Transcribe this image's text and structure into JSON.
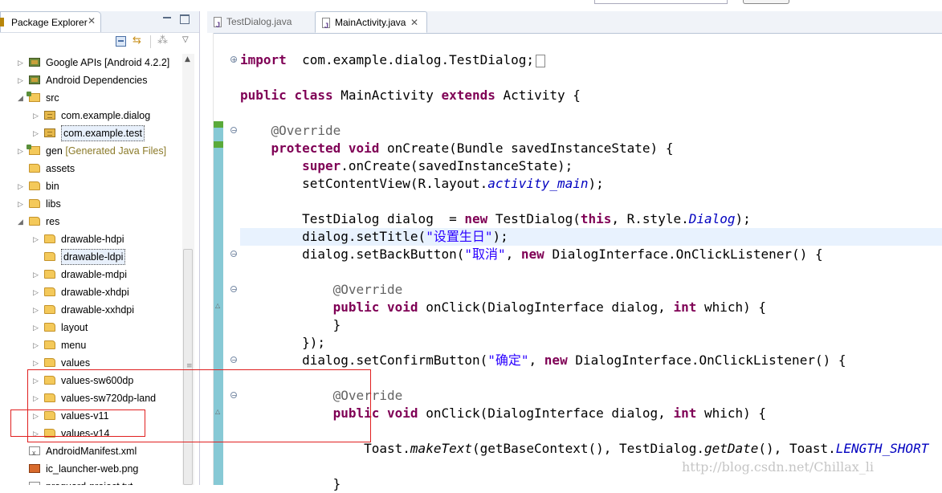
{
  "explorer": {
    "title": "Package Explorer",
    "close": "✕",
    "tree": [
      {
        "label": "Google APIs [Android 4.2.2]",
        "arrow": "▷",
        "icon": "library-icon",
        "indent": 0
      },
      {
        "label": "Android Dependencies",
        "arrow": "▷",
        "icon": "library-icon",
        "indent": 0
      },
      {
        "label": "src",
        "arrow": "◢",
        "icon": "source-folder-icon",
        "indent": 0
      },
      {
        "label": "com.example.dialog",
        "arrow": "▷",
        "icon": "package-icon",
        "indent": 1
      },
      {
        "label": "com.example.test",
        "arrow": "▷",
        "icon": "package-icon",
        "indent": 1,
        "selected": true
      },
      {
        "label": "gen",
        "sublabel": "[Generated Java Files]",
        "arrow": "▷",
        "icon": "source-folder-icon",
        "indent": 0
      },
      {
        "label": "assets",
        "arrow": "",
        "icon": "folder-icon",
        "indent": 0
      },
      {
        "label": "bin",
        "arrow": "▷",
        "icon": "folder-icon",
        "indent": 0
      },
      {
        "label": "libs",
        "arrow": "▷",
        "icon": "folder-icon",
        "indent": 0
      },
      {
        "label": "res",
        "arrow": "◢",
        "icon": "folder-icon",
        "indent": 0
      },
      {
        "label": "drawable-hdpi",
        "arrow": "▷",
        "icon": "folder-icon",
        "indent": 1
      },
      {
        "label": "drawable-ldpi",
        "arrow": "",
        "icon": "folder-icon",
        "indent": 1,
        "selected": true
      },
      {
        "label": "drawable-mdpi",
        "arrow": "▷",
        "icon": "folder-icon",
        "indent": 1
      },
      {
        "label": "drawable-xhdpi",
        "arrow": "▷",
        "icon": "folder-icon",
        "indent": 1
      },
      {
        "label": "drawable-xxhdpi",
        "arrow": "▷",
        "icon": "folder-icon",
        "indent": 1
      },
      {
        "label": "layout",
        "arrow": "▷",
        "icon": "folder-icon",
        "indent": 1
      },
      {
        "label": "menu",
        "arrow": "▷",
        "icon": "folder-icon",
        "indent": 1
      },
      {
        "label": "values",
        "arrow": "▷",
        "icon": "folder-icon",
        "indent": 1
      },
      {
        "label": "values-sw600dp",
        "arrow": "▷",
        "icon": "folder-icon",
        "indent": 1
      },
      {
        "label": "values-sw720dp-land",
        "arrow": "▷",
        "icon": "folder-icon",
        "indent": 1
      },
      {
        "label": "values-v11",
        "arrow": "▷",
        "icon": "folder-icon",
        "indent": 1
      },
      {
        "label": "values-v14",
        "arrow": "▷",
        "icon": "folder-icon",
        "indent": 1
      },
      {
        "label": "AndroidManifest.xml",
        "arrow": "",
        "icon": "xml-file-icon",
        "indent": 0
      },
      {
        "label": "ic_launcher-web.png",
        "arrow": "",
        "icon": "image-file-icon",
        "indent": 0
      },
      {
        "label": "proguard-project.txt",
        "arrow": "",
        "icon": "text-file-icon",
        "indent": 0
      }
    ]
  },
  "editor": {
    "tabs": [
      {
        "label": "TestDialog.java",
        "active": false,
        "close": ""
      },
      {
        "label": "MainActivity.java",
        "active": true,
        "close": "✕"
      }
    ],
    "lines": [
      [
        [
          "kw",
          "import"
        ],
        [
          "",
          "  com.example.dialog.TestDialog;"
        ]
      ],
      [],
      [
        [
          "kw",
          "public"
        ],
        [
          "",
          " "
        ],
        [
          "kw",
          "class"
        ],
        [
          "",
          " MainActivity "
        ],
        [
          "kw",
          "extends"
        ],
        [
          "",
          " Activity {"
        ]
      ],
      [],
      [
        [
          "",
          "    "
        ],
        [
          "an",
          "@Override"
        ]
      ],
      [
        [
          "",
          "    "
        ],
        [
          "kw",
          "protected"
        ],
        [
          "",
          " "
        ],
        [
          "kw",
          "void"
        ],
        [
          "",
          " onCreate(Bundle savedInstanceState) {"
        ]
      ],
      [
        [
          "",
          "        "
        ],
        [
          "kw",
          "super"
        ],
        [
          "",
          ".onCreate(savedInstanceState);"
        ]
      ],
      [
        [
          "",
          "        setContentView(R.layout."
        ],
        [
          "it",
          "activity_main"
        ],
        [
          "",
          ");"
        ]
      ],
      [],
      [
        [
          "",
          "        TestDialog dialog  = "
        ],
        [
          "kw",
          "new"
        ],
        [
          "",
          " TestDialog("
        ],
        [
          "kw",
          "this"
        ],
        [
          "",
          ", R.style."
        ],
        [
          "it",
          "Dialog"
        ],
        [
          "",
          ");"
        ]
      ],
      [
        [
          "",
          "        dialog.setTitle("
        ],
        [
          "st",
          "\"设置生日\""
        ],
        [
          "",
          ");"
        ]
      ],
      [
        [
          "",
          "        dialog.setBackButton("
        ],
        [
          "st",
          "\"取消\""
        ],
        [
          "",
          ", "
        ],
        [
          "kw",
          "new"
        ],
        [
          "",
          " DialogInterface.OnClickListener() {"
        ]
      ],
      [],
      [
        [
          "",
          "            "
        ],
        [
          "an",
          "@Override"
        ]
      ],
      [
        [
          "",
          "            "
        ],
        [
          "kw",
          "public"
        ],
        [
          "",
          " "
        ],
        [
          "kw",
          "void"
        ],
        [
          "",
          " onClick(DialogInterface dialog, "
        ],
        [
          "kw",
          "int"
        ],
        [
          "",
          " which) {"
        ]
      ],
      [
        [
          "",
          "            }"
        ]
      ],
      [
        [
          "",
          "        });"
        ]
      ],
      [
        [
          "",
          "        dialog.setConfirmButton("
        ],
        [
          "st",
          "\"确定\""
        ],
        [
          "",
          ", "
        ],
        [
          "kw",
          "new"
        ],
        [
          "",
          " DialogInterface.OnClickListener() {"
        ]
      ],
      [],
      [
        [
          "",
          "            "
        ],
        [
          "an",
          "@Override"
        ]
      ],
      [
        [
          "",
          "            "
        ],
        [
          "kw",
          "public"
        ],
        [
          "",
          " "
        ],
        [
          "kw",
          "void"
        ],
        [
          "",
          " onClick(DialogInterface dialog, "
        ],
        [
          "kw",
          "int"
        ],
        [
          "",
          " which) {"
        ]
      ],
      [],
      [
        [
          "",
          "                Toast."
        ],
        [
          "sm",
          "makeText"
        ],
        [
          "",
          "(getBaseContext(), TestDialog."
        ],
        [
          "sm",
          "getDate"
        ],
        [
          "",
          "(), Toast."
        ],
        [
          "it",
          "LENGTH_SHORT"
        ]
      ],
      [],
      [
        [
          "",
          "            }"
        ]
      ]
    ]
  },
  "watermark": "http://blog.csdn.net/Chillax_li",
  "colors": {
    "keyword": "#7f0055",
    "string": "#2a00ff",
    "annotation": "#646464",
    "field": "#0000c0",
    "highlight": "#e02020"
  }
}
